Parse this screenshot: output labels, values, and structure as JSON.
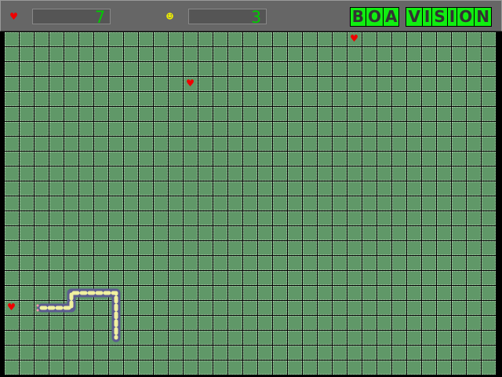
{
  "hud": {
    "lives": "7",
    "score": "3",
    "lives_icon": "heart-icon",
    "score_icon": "smiley-icon",
    "logo": [
      "BOA",
      "VISION"
    ]
  },
  "board": {
    "columns": 33,
    "rows": 23,
    "hearts": [
      [
        23,
        0
      ],
      [
        12,
        3
      ],
      [
        0,
        18
      ]
    ],
    "snake": [
      [
        2,
        18
      ],
      [
        3,
        18
      ],
      [
        4,
        18
      ],
      [
        4,
        17
      ],
      [
        5,
        17
      ],
      [
        6,
        17
      ],
      [
        7,
        17
      ],
      [
        7,
        18
      ],
      [
        7,
        19
      ],
      [
        7,
        20
      ]
    ]
  },
  "colors": {
    "cell": "#609868",
    "snake": "#5c5c90",
    "snake_stripe": "#f0f0a0",
    "heart": "#ee0000",
    "digits": "#00cc00"
  }
}
